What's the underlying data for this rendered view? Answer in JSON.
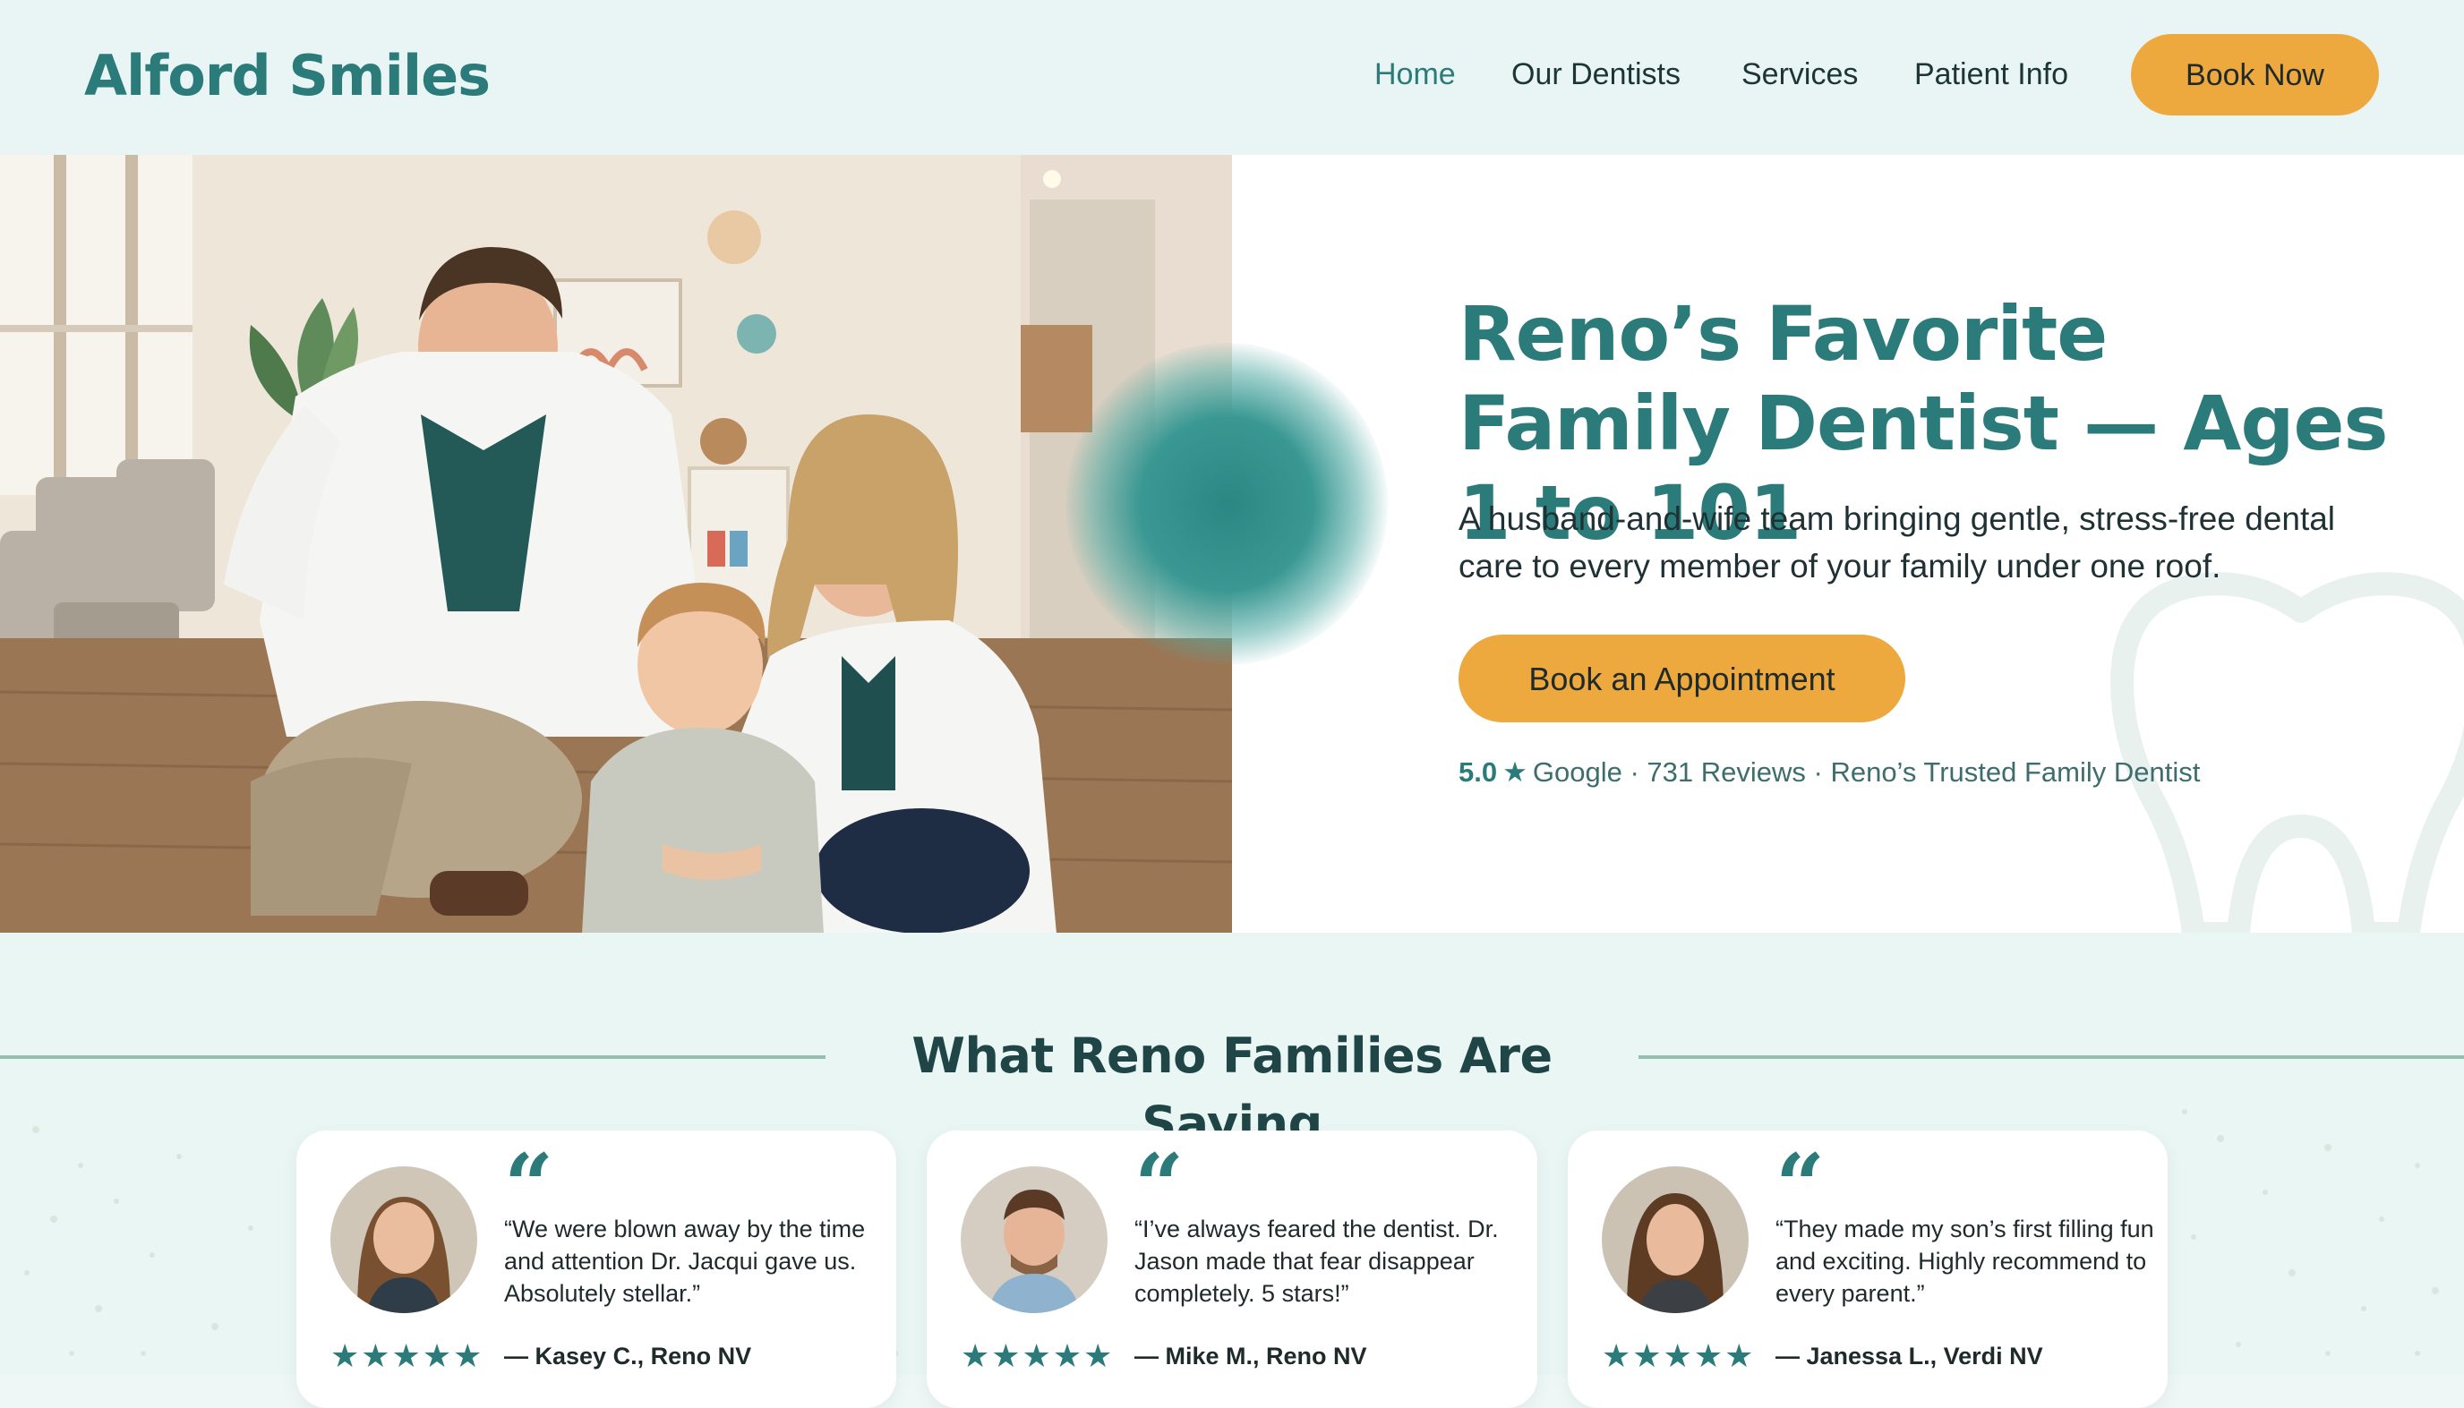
{
  "header": {
    "logo": "Alford Smiles",
    "nav": [
      {
        "label": "Home",
        "active": true
      },
      {
        "label": "Our Dentists",
        "active": false
      },
      {
        "label": "Services",
        "active": false
      },
      {
        "label": "Patient Info",
        "active": false
      }
    ],
    "cta": "Book Now"
  },
  "hero": {
    "title": "Reno’s Favorite Family Dentist — Ages 1 to 101",
    "subtitle": "A husband-and-wife team bringing gentle, stress-free dental care to every member of your family under one roof.",
    "cta": "Book an Appointment",
    "rating": {
      "score": "5.0",
      "star_icon": "star-icon",
      "text": "Google · 731 Reviews · Reno’s Trusted Family Dentist"
    },
    "photo_icon": "family-dentists-photo"
  },
  "testimonials": {
    "title": "What Reno Families Are Saying",
    "quote_glyph": "“",
    "items": [
      {
        "quote": "“We were blown away by the time and attention Dr. Jacqui gave us. Absolutely stellar.”",
        "author": "— Kasey C., Reno NV",
        "stars": "★★★★★",
        "rating": 5
      },
      {
        "quote": "“I’ve always feared the dentist. Dr. Jason made that fear disappear completely. 5 stars!”",
        "author": "— Mike M., Reno NV",
        "stars": "★★★★★",
        "rating": 5
      },
      {
        "quote": "“They made my son’s first filling fun and exciting. Highly recommend to every parent.”",
        "author": "— Janessa L., Verdi NV",
        "stars": "★★★★★",
        "rating": 5
      }
    ]
  },
  "colors": {
    "brand_teal": "#2a7b79",
    "cta_orange": "#eea93e",
    "header_bg": "#e8f5f4",
    "section_bg": "#eaf6f4"
  }
}
